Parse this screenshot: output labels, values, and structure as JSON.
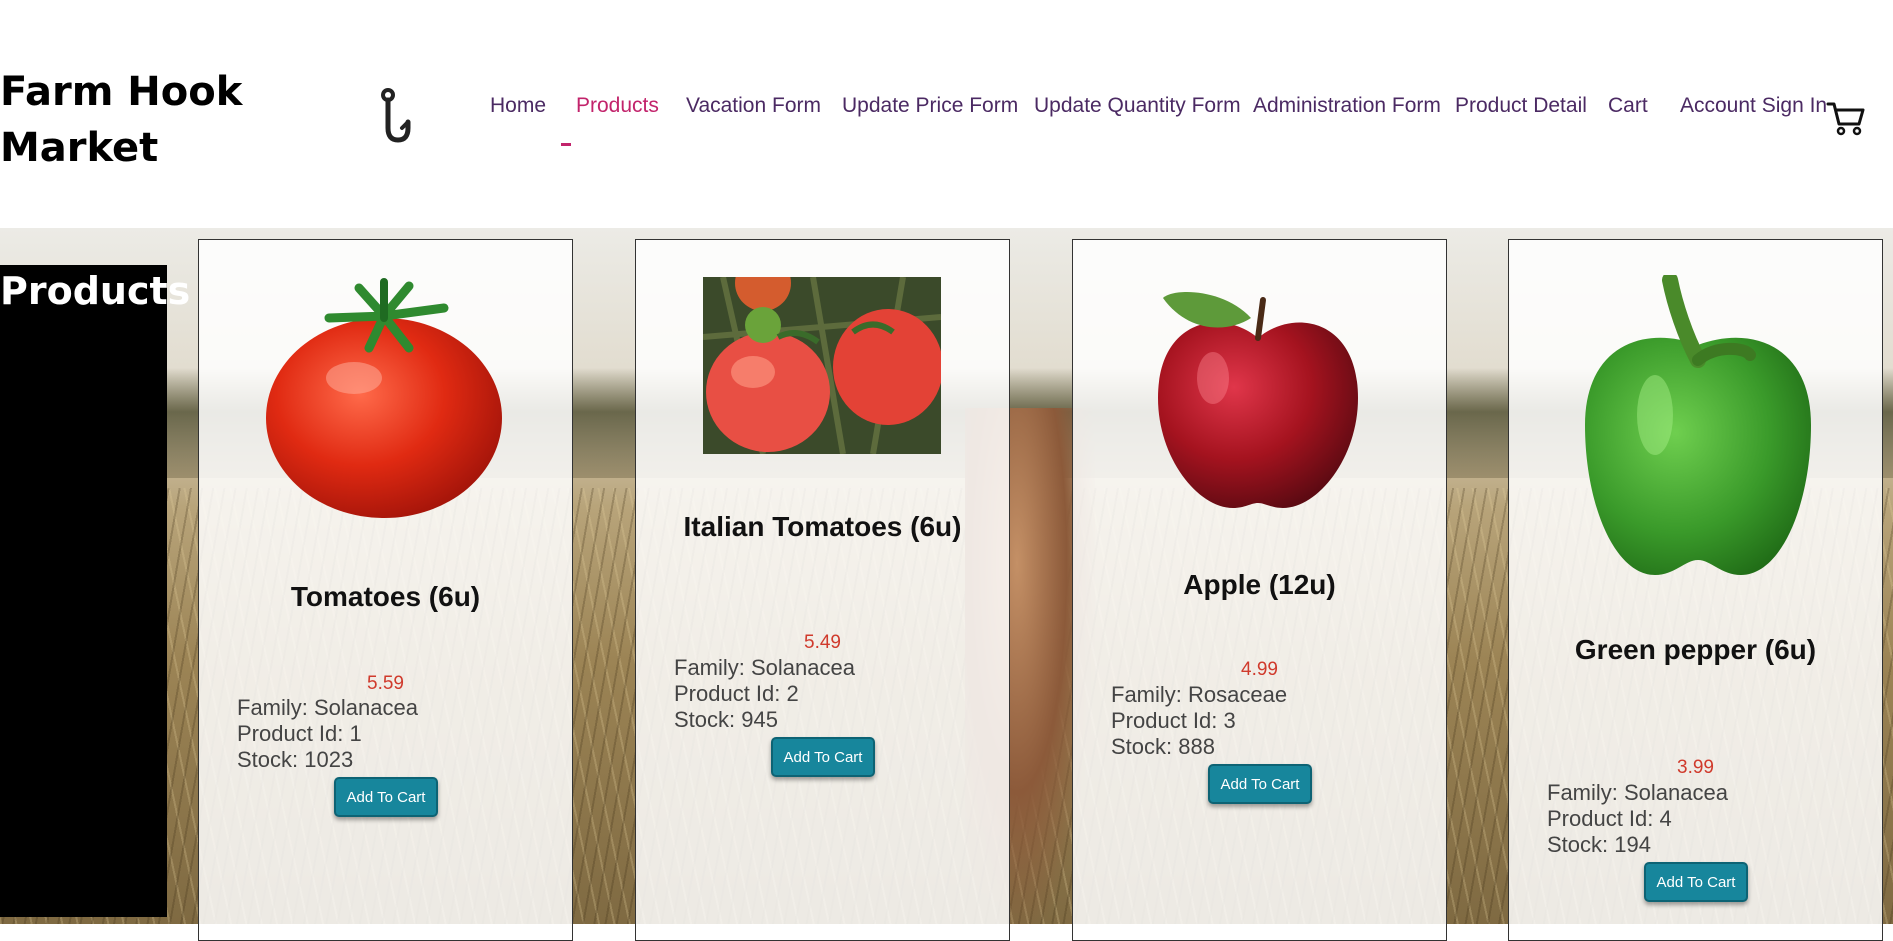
{
  "brand": {
    "title": "Farm Hook Market"
  },
  "nav": {
    "items": [
      {
        "label": "Home"
      },
      {
        "label": "Products"
      },
      {
        "label": "Vacation Form"
      },
      {
        "label": "Update Price Form"
      },
      {
        "label": "Update Quantity Form"
      },
      {
        "label": "Administration Form"
      },
      {
        "label": "Product Detail"
      },
      {
        "label": "Cart"
      },
      {
        "label": "Account Sign In"
      }
    ],
    "active": "Products",
    "icons": {
      "logo": "hook-icon",
      "cart": "cart-icon"
    },
    "colors": {
      "link": "#4b2a63",
      "active": "#c2236b"
    }
  },
  "page": {
    "title": "Products"
  },
  "products": [
    {
      "name": "Tomatoes (6u)",
      "price": "5.59",
      "family": "Family: Solanacea",
      "product_id": "Product Id: 1",
      "stock": "Stock: 1023",
      "button": "Add To Cart",
      "image": "tomato-icon"
    },
    {
      "name": "Italian Tomatoes (6u)",
      "price": "5.49",
      "family": "Family: Solanacea",
      "product_id": "Product Id: 2",
      "stock": "Stock: 945",
      "button": "Add To Cart",
      "image": "vine-tomatoes-photo"
    },
    {
      "name": "Apple (12u)",
      "price": "4.99",
      "family": "Family: Rosaceae",
      "product_id": "Product Id: 3",
      "stock": "Stock: 888",
      "button": "Add To Cart",
      "image": "apple-icon"
    },
    {
      "name": "Green pepper (6u)",
      "price": "3.99",
      "family": "Family: Solanacea",
      "product_id": "Product Id: 4",
      "stock": "Stock: 194",
      "button": "Add To Cart",
      "image": "green-pepper-icon"
    }
  ],
  "colors": {
    "price": "#d03a2c",
    "button": "#17869c"
  }
}
